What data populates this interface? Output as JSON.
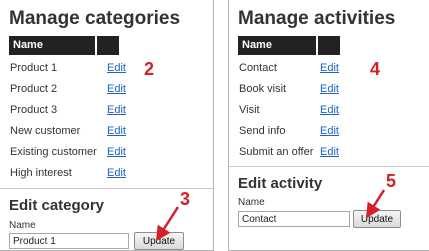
{
  "categories": {
    "title": "Manage categories",
    "column_name": "Name",
    "edit_label": "Edit",
    "items": [
      {
        "name": "Product 1"
      },
      {
        "name": "Product 2"
      },
      {
        "name": "Product 3"
      },
      {
        "name": "New customer"
      },
      {
        "name": "Existing customer"
      },
      {
        "name": "High interest"
      }
    ],
    "edit_form": {
      "title": "Edit category",
      "name_label": "Name",
      "name_value": "Product 1",
      "update_label": "Update"
    }
  },
  "activities": {
    "title": "Manage activities",
    "column_name": "Name",
    "edit_label": "Edit",
    "items": [
      {
        "name": "Contact"
      },
      {
        "name": "Book visit"
      },
      {
        "name": "Visit"
      },
      {
        "name": "Send info"
      },
      {
        "name": "Submit an offer"
      }
    ],
    "edit_form": {
      "title": "Edit activity",
      "name_label": "Name",
      "name_value": "Contact",
      "update_label": "Update"
    }
  },
  "callouts": {
    "step_2": "2",
    "step_3": "3",
    "step_4": "4",
    "step_5": "5",
    "color": "#d42026"
  }
}
